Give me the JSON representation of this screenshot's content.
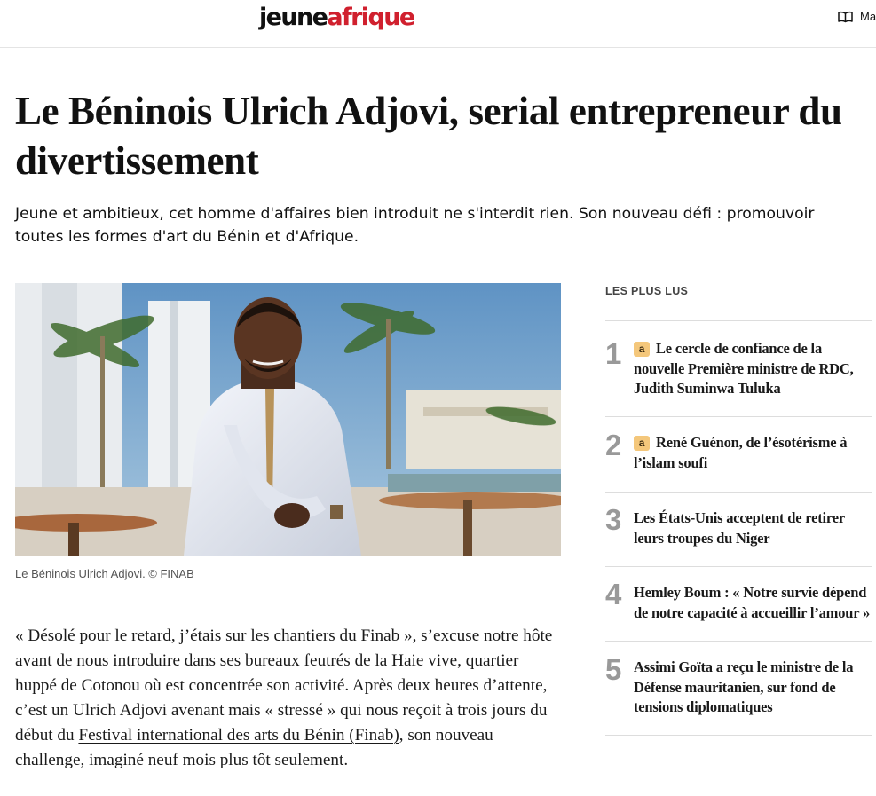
{
  "header": {
    "logo_part1": "jeune",
    "logo_part2": "afrique",
    "magazine_label": "Ma"
  },
  "article": {
    "title": "Le Béninois Ulrich Adjovi, serial entrepreneur du divertissement",
    "chapo": "Jeune et ambitieux, cet homme d'affaires bien introduit ne s'interdit rien. Son nouveau défi : promouvoir toutes les formes d'art du Bénin et d'Afrique.",
    "image_caption": "Le Béninois Ulrich Adjovi. © FINAB",
    "body_part1": "« Désolé pour le retard, j’étais sur les chantiers du Finab », s’excuse notre hôte avant de nous introduire dans ses bureaux feutrés de la Haie vive, quartier huppé de Cotonou où est concentrée son activité. Après deux heures d’attente, c’est un Ulrich Adjovi avenant mais « stressé » qui nous reçoit à trois jours du début du ",
    "body_link": "Festival international des arts du Bénin (Finab)",
    "body_part2": ", son nouveau challenge, imaginé neuf mois plus tôt seulement."
  },
  "most_read": {
    "title": "LES PLUS LUS",
    "badge_letter": "a",
    "items": [
      {
        "rank": "1",
        "premium": true,
        "title": "Le cercle de confiance de la nouvelle Première ministre de RDC, Judith Suminwa Tuluka"
      },
      {
        "rank": "2",
        "premium": true,
        "title": "René Guénon, de l’ésotérisme à l’islam soufi"
      },
      {
        "rank": "3",
        "premium": false,
        "title": "Les États-Unis acceptent de retirer leurs troupes du Niger"
      },
      {
        "rank": "4",
        "premium": false,
        "title": "Hemley Boum : « Notre survie dépend de notre capacité à accueillir l’amour »"
      },
      {
        "rank": "5",
        "premium": false,
        "title": "Assimi Goïta a reçu le ministre de la Défense mauritanien, sur fond de tensions diplomatiques"
      }
    ]
  },
  "colors": {
    "brand_red": "#d0202e",
    "badge_bg": "#f4c77b",
    "rank_gray": "#999999"
  },
  "icons": {
    "magazine": "open-book-icon",
    "premium": "premium-badge-icon"
  }
}
